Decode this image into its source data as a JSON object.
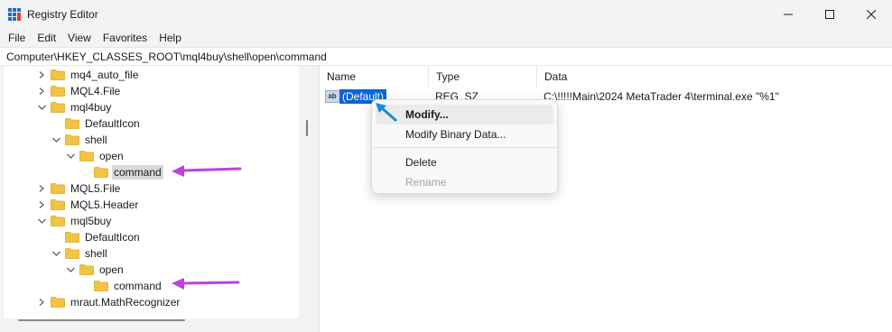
{
  "window": {
    "title": "Registry Editor",
    "icon": "registry-editor-icon",
    "controls": [
      "minimize-icon",
      "maximize-icon",
      "close-icon"
    ]
  },
  "menu": [
    "File",
    "Edit",
    "View",
    "Favorites",
    "Help"
  ],
  "address": "Computer\\HKEY_CLASSES_ROOT\\mql4buy\\shell\\open\\command",
  "tree": [
    {
      "label": "mq4_auto_file",
      "chevron": "right"
    },
    {
      "label": "MQL4.File",
      "chevron": "right"
    },
    {
      "label": "mql4buy",
      "chevron": "down"
    },
    {
      "label": "DefaultIcon",
      "chevron": "none"
    },
    {
      "label": "shell",
      "chevron": "down"
    },
    {
      "label": "open",
      "chevron": "down"
    },
    {
      "label": "command",
      "chevron": "none",
      "selected": true
    },
    {
      "label": "MQL5.File",
      "chevron": "right"
    },
    {
      "label": "MQL5.Header",
      "chevron": "right"
    },
    {
      "label": "mql5buy",
      "chevron": "down"
    },
    {
      "label": "DefaultIcon",
      "chevron": "none"
    },
    {
      "label": "shell",
      "chevron": "down"
    },
    {
      "label": "open",
      "chevron": "down"
    },
    {
      "label": "command",
      "chevron": "none"
    },
    {
      "label": "mraut.MathRecognizer",
      "chevron": "right"
    }
  ],
  "columns": [
    "Name",
    "Type",
    "Data"
  ],
  "values": [
    {
      "name": "(Default)",
      "type": "REG_SZ",
      "data": "C:\\!!!!!Main\\2024 MetaTrader 4\\terminal.exe \"%1\"",
      "icon": "ab-string-icon"
    }
  ],
  "context_menu": {
    "items": [
      {
        "label": "Modify...",
        "state": "hover"
      },
      {
        "label": "Modify Binary Data...",
        "state": "normal"
      },
      {
        "label": "Delete",
        "state": "normal"
      },
      {
        "label": "Rename",
        "state": "disabled"
      }
    ]
  },
  "colors": {
    "selection": "#0a64d4",
    "annotation_arrow": "#c040e0",
    "cursor_arrow": "#1a8ad8",
    "folder": "#f2c443"
  }
}
